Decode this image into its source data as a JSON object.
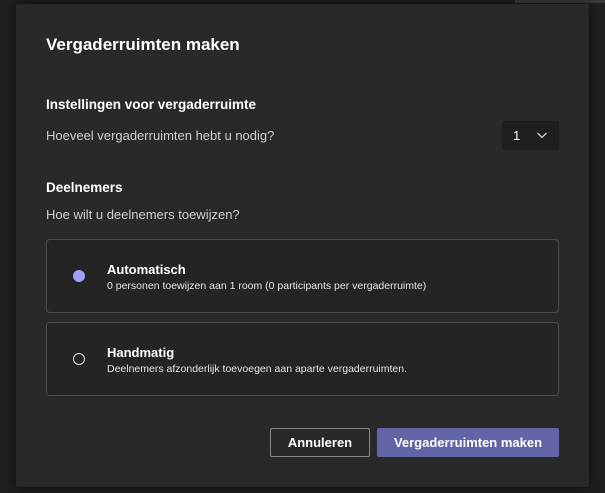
{
  "dialog": {
    "title": "Vergaderruimten maken"
  },
  "settings": {
    "heading": "Instellingen voor vergaderruimte",
    "question": "Hoeveel vergaderruimten hebt u nodig?",
    "room_count": "1"
  },
  "participants": {
    "heading": "Deelnemers",
    "question": "Hoe wilt u deelnemers toewijzen?",
    "options": [
      {
        "title": "Automatisch",
        "description": "0 personen toewijzen aan 1 room (0 participants per vergaderruimte)",
        "selected": true
      },
      {
        "title": "Handmatig",
        "description": "Deelnemers afzonderlijk toevoegen aan aparte vergaderruimten.",
        "selected": false
      }
    ]
  },
  "buttons": {
    "cancel_label": "Annuleren",
    "create_label": "Vergaderruimten maken"
  },
  "colors": {
    "accent": "#6264a7",
    "radio_selected": "#9ea2ff",
    "dialog_bg": "#292929"
  },
  "icons": {
    "select_chevron": "chevron-down-icon"
  }
}
